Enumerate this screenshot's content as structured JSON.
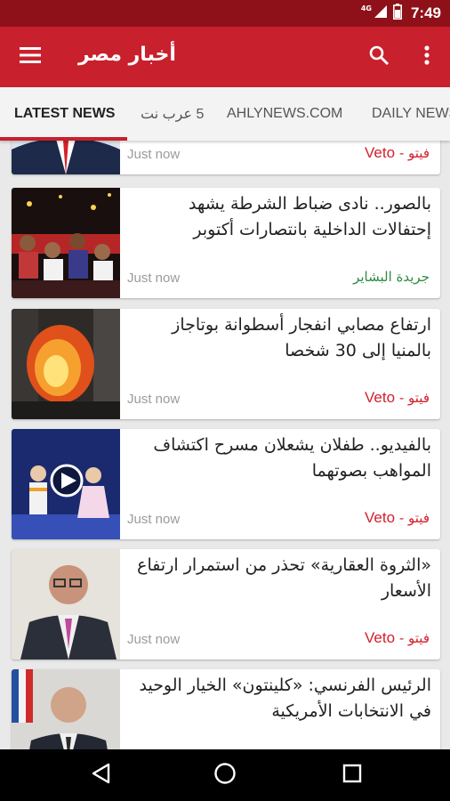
{
  "status_bar": {
    "network_label": "4G",
    "time": "7:49",
    "icons": [
      "signal-icon",
      "battery-icon"
    ]
  },
  "app_bar": {
    "title": "أخبار مصر",
    "icons": [
      "menu-icon",
      "search-icon",
      "more-vert-icon"
    ]
  },
  "tabs": [
    {
      "label": "LATEST NEWS",
      "active": true
    },
    {
      "label": "5 عرب نت",
      "active": false
    },
    {
      "label": "AHLYNEWS.COM",
      "active": false
    },
    {
      "label": "DAILY NEWS",
      "active": false
    }
  ],
  "articles": [
    {
      "title": "",
      "time": "Just now",
      "source_ar": "فيتو",
      "source_sep": " - ",
      "source_en": "Veto",
      "source_color": "#d2202d",
      "thumbnail": "suit-portrait"
    },
    {
      "title": "بالصور.. نادى ضباط الشرطة يشهد إحتفالات الداخلية بانتصارات أكتوبر",
      "time": "Just now",
      "source_ar": "جريدة البشاير",
      "source_sep": "",
      "source_en": "",
      "source_color": "#2e8b43",
      "thumbnail": "children-celebration"
    },
    {
      "title": "ارتفاع مصابي انفجار أسطوانة بوتاجاز بالمنيا إلى 30 شخصا",
      "time": "Just now",
      "source_ar": "فيتو",
      "source_sep": " - ",
      "source_en": "Veto",
      "source_color": "#d2202d",
      "thumbnail": "fire-explosion"
    },
    {
      "title": "بالفيديو.. طفلان يشعلان مسرح اكتشاف المواهب بصوتهما",
      "time": "Just now",
      "source_ar": "فيتو",
      "source_sep": " - ",
      "source_en": "Veto",
      "source_color": "#d2202d",
      "thumbnail": "stage-video"
    },
    {
      "title": "«الثروة العقارية» تحذر من استمرار ارتفاع الأسعار",
      "time": "Just now",
      "source_ar": "فيتو",
      "source_sep": " - ",
      "source_en": "Veto",
      "source_color": "#d2202d",
      "thumbnail": "man-glasses"
    },
    {
      "title": "الرئيس الفرنسي: «كلينتون» الخيار الوحيد في الانتخابات الأمريكية",
      "time": "",
      "source_ar": "",
      "source_sep": "",
      "source_en": "",
      "source_color": "#d2202d",
      "thumbnail": "president-podium"
    }
  ],
  "nav_bar": {
    "icons": [
      "back-icon",
      "home-icon",
      "recents-icon"
    ]
  }
}
